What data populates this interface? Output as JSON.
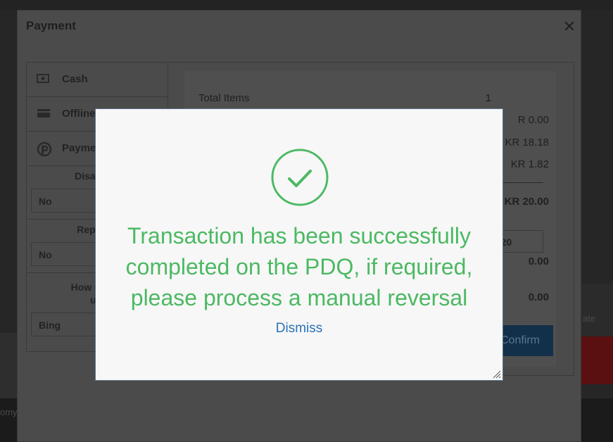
{
  "payment_modal": {
    "title": "Payment",
    "close_glyph": "✕",
    "methods": [
      {
        "label": "Cash",
        "icon": "cash-icon"
      },
      {
        "label": "Offline",
        "icon": "card-icon"
      },
      {
        "label": "Payme",
        "icon": "payment-icon"
      }
    ],
    "fields": [
      {
        "label": "Disable N",
        "value": "No"
      },
      {
        "label": "Repair &",
        "value": "No"
      },
      {
        "label": "How did yo",
        "label_line2": "u",
        "value": "Bing"
      }
    ],
    "summary": {
      "total_items_label": "Total Items",
      "total_items_value": "1",
      "row_values": [
        "R 0.00",
        "KR 18.18",
        "KR 1.82"
      ],
      "total_value": "KR 20.00",
      "input_value": "-20",
      "value_a": "0.00",
      "value_b": "0.00"
    },
    "confirm_label": "Confirm"
  },
  "background": {
    "right_ghost_text": "ate",
    "left_ghost_text": "omy"
  },
  "alert": {
    "message": "Transaction has been successfully completed on the PDQ, if required, please process a manual reversal",
    "dismiss_label": "Dismiss",
    "icon": "check-circle-icon",
    "accent_color": "#4cb963",
    "link_color": "#2a72b5"
  }
}
